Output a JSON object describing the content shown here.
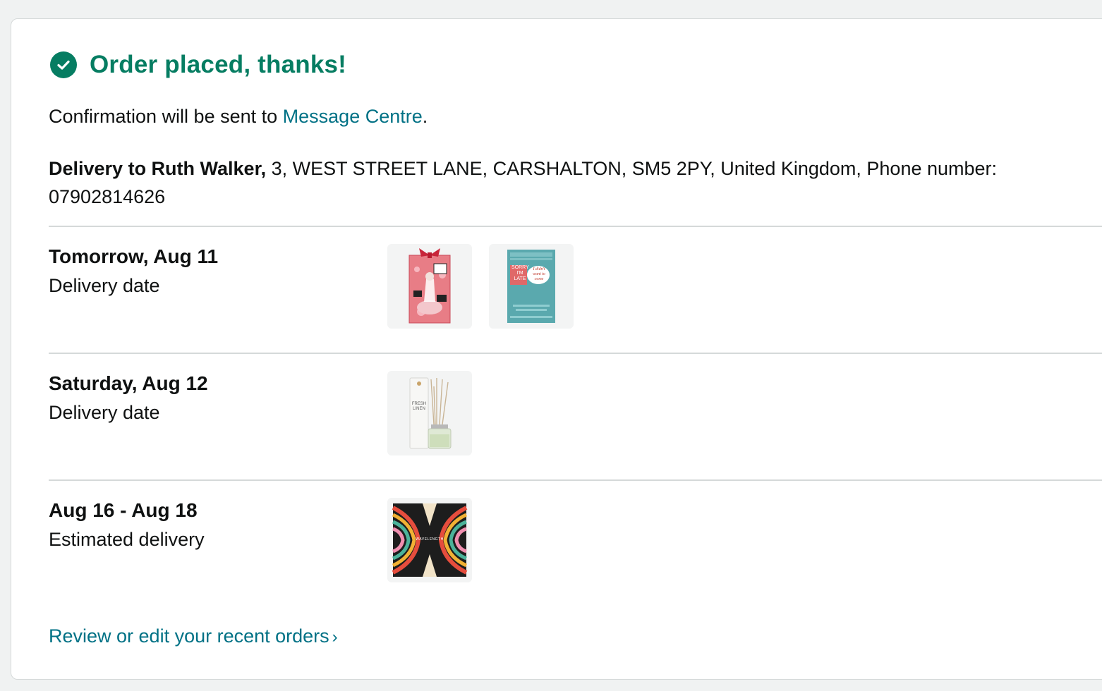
{
  "header": {
    "title": "Order placed, thanks!",
    "icon": "check-circle-icon",
    "color": "#067d62"
  },
  "confirmation": {
    "prefix": "Confirmation will be sent to ",
    "link": "Message Centre",
    "suffix": "."
  },
  "delivery": {
    "bold": "Delivery to Ruth Walker,",
    "address": " 3, WEST STREET LANE, CARSHALTON, SM5 2PY, United Kingdom, Phone number: 07902814626"
  },
  "groups": [
    {
      "date": "Tomorrow, Aug 11",
      "label": "Delivery date",
      "items": [
        "gift-box-product-image",
        "book-product-image"
      ]
    },
    {
      "date": "Saturday, Aug 12",
      "label": "Delivery date",
      "items": [
        "reed-diffuser-product-image"
      ]
    },
    {
      "date": "Aug 16 - Aug 18",
      "label": "Estimated delivery",
      "items": [
        "board-game-product-image"
      ]
    }
  ],
  "book_cover": {
    "line1": "SORRY",
    "line2": "I'M",
    "line3": "LATE",
    "handwriting": "I didn't want to come"
  },
  "diffuser": {
    "line1": "FRESH",
    "line2": "LINEN"
  },
  "game": {
    "title": "WAVELENGTH"
  },
  "footer": {
    "review_link": "Review or edit your recent orders",
    "chevron": "chevron-right-icon"
  }
}
